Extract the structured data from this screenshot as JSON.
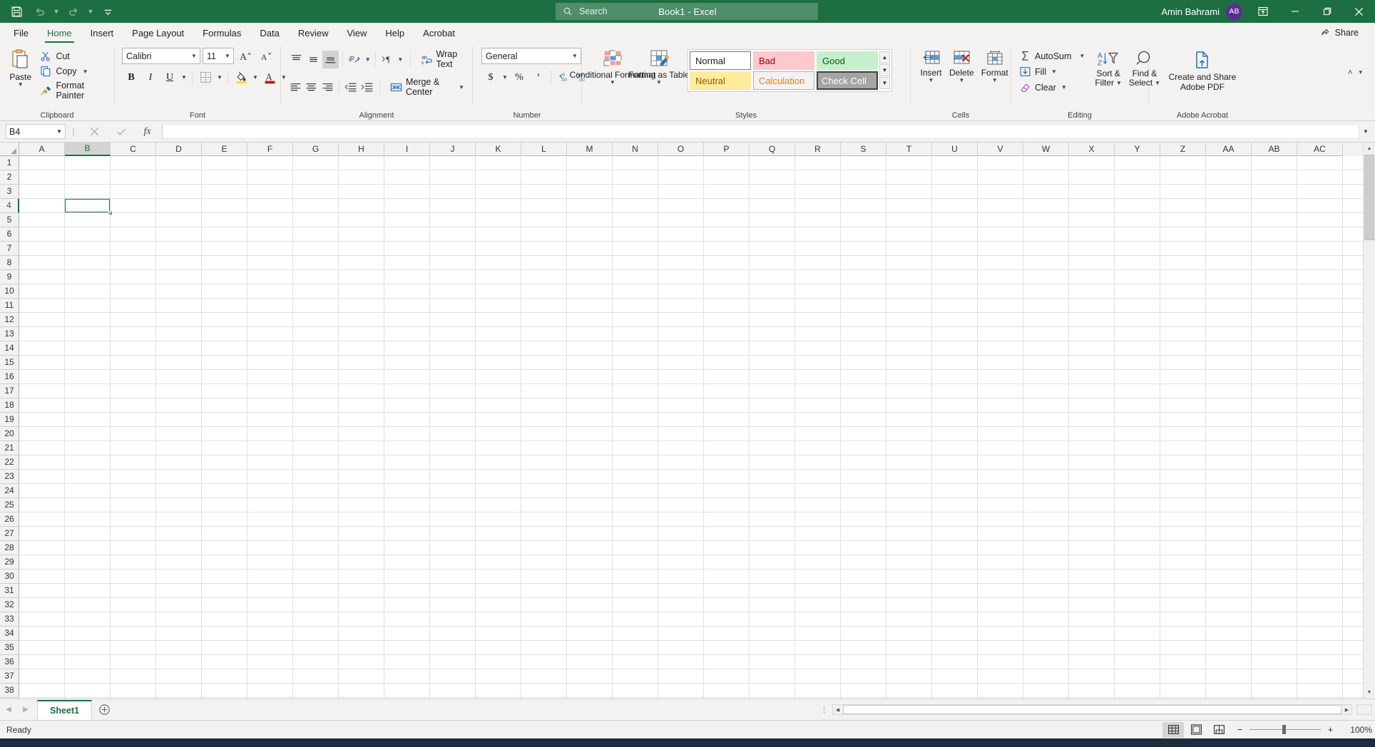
{
  "titlebar": {
    "quick_access": [
      {
        "name": "save-icon",
        "label": "Save"
      },
      {
        "name": "undo-icon",
        "label": "Undo"
      },
      {
        "name": "redo-icon",
        "label": "Redo"
      },
      {
        "name": "customize-qat-icon",
        "label": "Customize Quick Access Toolbar"
      }
    ],
    "title": "Book1  -  Excel",
    "search_placeholder": "Search",
    "account_name": "Amin Bahrami",
    "account_initials": "AB",
    "ribbon_display_label": "Ribbon Display Options",
    "minimize_label": "Minimize",
    "restore_label": "Restore Down",
    "close_label": "Close"
  },
  "tabs": [
    {
      "label": "File",
      "active": false
    },
    {
      "label": "Home",
      "active": true
    },
    {
      "label": "Insert",
      "active": false
    },
    {
      "label": "Page Layout",
      "active": false
    },
    {
      "label": "Formulas",
      "active": false
    },
    {
      "label": "Data",
      "active": false
    },
    {
      "label": "Review",
      "active": false
    },
    {
      "label": "View",
      "active": false
    },
    {
      "label": "Help",
      "active": false
    },
    {
      "label": "Acrobat",
      "active": false
    }
  ],
  "share": {
    "label": "Share"
  },
  "ribbon": {
    "clipboard": {
      "group_label": "Clipboard",
      "paste": "Paste",
      "cut": "Cut",
      "copy": "Copy",
      "format_painter": "Format Painter"
    },
    "font": {
      "group_label": "Font",
      "font_name": "Calibri",
      "font_size": "11",
      "grow_font": "Increase Font Size",
      "shrink_font": "Decrease Font Size",
      "bold": "B",
      "italic": "I",
      "underline": "U",
      "borders": "Borders",
      "fill_color": "Fill Color",
      "font_color": "Font Color"
    },
    "alignment": {
      "group_label": "Alignment",
      "top_align": "Top Align",
      "middle_align": "Middle Align",
      "bottom_align": "Bottom Align",
      "orientation": "Orientation",
      "text_direction": "Text Direction",
      "wrap_text": "Wrap Text",
      "align_left": "Align Left",
      "center": "Center",
      "align_right": "Align Right",
      "decrease_indent": "Decrease Indent",
      "increase_indent": "Increase Indent",
      "merge_center": "Merge & Center"
    },
    "number": {
      "group_label": "Number",
      "format": "General",
      "accounting": "Accounting Number Format",
      "percent": "%",
      "comma": "Comma Style",
      "increase_decimal": "Increase Decimal",
      "decrease_decimal": "Decrease Decimal"
    },
    "styles": {
      "group_label": "Styles",
      "conditional_formatting": "Conditional Formatting",
      "format_as_table": "Format as Table",
      "cells": [
        {
          "label": "Normal",
          "bg": "#ffffff",
          "fg": "#1a1a1a",
          "border": "#7a7a7a",
          "selected": true
        },
        {
          "label": "Bad",
          "bg": "#ffc7ce",
          "fg": "#9c0006",
          "border": "transparent",
          "selected": false
        },
        {
          "label": "Good",
          "bg": "#c6efce",
          "fg": "#006100",
          "border": "transparent",
          "selected": false
        },
        {
          "label": "Neutral",
          "bg": "#ffeb9c",
          "fg": "#9c5700",
          "border": "transparent",
          "selected": false
        },
        {
          "label": "Calculation",
          "bg": "#f2f2f2",
          "fg": "#fa7d00",
          "border": "#b2b2b2",
          "selected": false
        },
        {
          "label": "Check Cell",
          "bg": "#a5a5a5",
          "fg": "#ffffff",
          "border": "#3f3f3f",
          "selected": false
        }
      ]
    },
    "cells_group": {
      "group_label": "Cells",
      "insert": "Insert",
      "delete": "Delete",
      "format": "Format"
    },
    "editing": {
      "group_label": "Editing",
      "autosum": "AutoSum",
      "fill": "Fill",
      "clear": "Clear",
      "sort_filter_line1": "Sort &",
      "sort_filter_line2": "Filter",
      "find_select_line1": "Find &",
      "find_select_line2": "Select"
    },
    "acrobat": {
      "group_label": "Adobe Acrobat",
      "create_share_line1": "Create and Share",
      "create_share_line2": "Adobe PDF"
    },
    "collapse_label": "Collapse the Ribbon"
  },
  "formula_bar": {
    "name_box": "B4",
    "cancel": "Cancel",
    "enter": "Enter",
    "insert_function": "fx",
    "value": "",
    "expand": "Expand Formula Bar"
  },
  "grid": {
    "columns": [
      "A",
      "B",
      "C",
      "D",
      "E",
      "F",
      "G",
      "H",
      "I",
      "J",
      "K",
      "L",
      "M",
      "N",
      "O",
      "P",
      "Q",
      "R",
      "S",
      "T",
      "U",
      "V",
      "W",
      "X",
      "Y",
      "Z",
      "AA",
      "AB",
      "AC"
    ],
    "rows": [
      1,
      2,
      3,
      4,
      5,
      6,
      7,
      8,
      9,
      10,
      11,
      12,
      13,
      14,
      15,
      16,
      17,
      18,
      19,
      20,
      21,
      22,
      23,
      24,
      25,
      26,
      27,
      28,
      29,
      30,
      31,
      32,
      33,
      34,
      35,
      36,
      37,
      38
    ],
    "selected_cell": "B4",
    "selected_column": "B",
    "selected_row": 4,
    "accent_color": "#1d6f42"
  },
  "sheetbar": {
    "prev_label": "Previous Sheet",
    "next_label": "Next Sheet",
    "sheets": [
      {
        "label": "Sheet1",
        "active": true
      }
    ],
    "add_sheet_label": "New sheet"
  },
  "statusbar": {
    "status": "Ready",
    "views": [
      {
        "name": "normal-view-icon",
        "label": "Normal",
        "active": true
      },
      {
        "name": "page-layout-view-icon",
        "label": "Page Layout",
        "active": false
      },
      {
        "name": "page-break-preview-icon",
        "label": "Page Break Preview",
        "active": false
      }
    ],
    "zoom_out": "−",
    "zoom_in": "+",
    "zoom_value": "100%"
  }
}
